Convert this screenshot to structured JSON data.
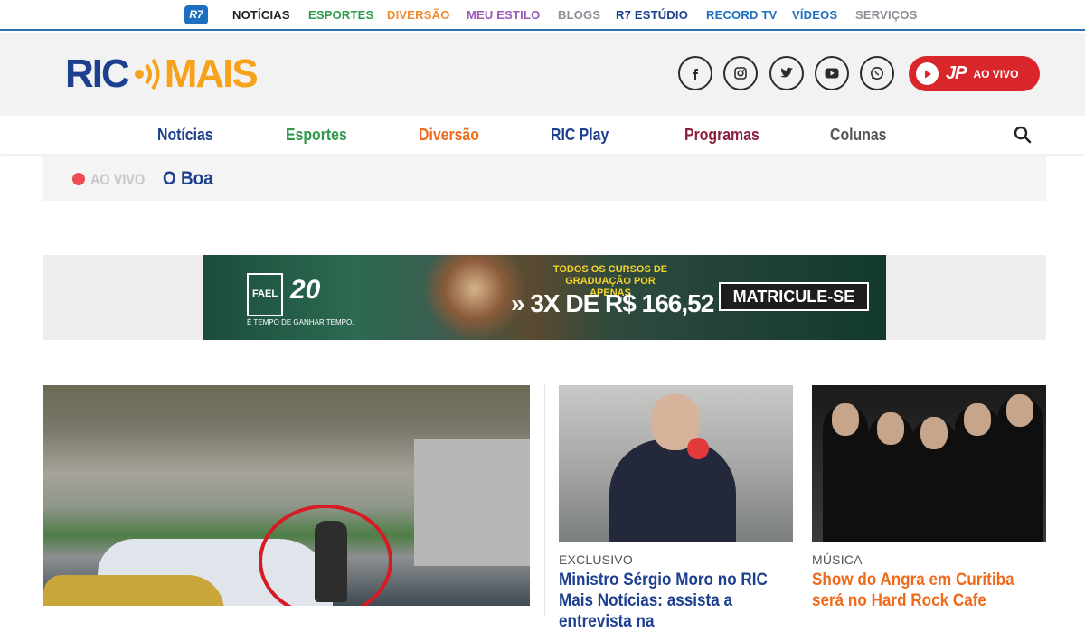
{
  "r7bar": {
    "logo": "R7",
    "items": [
      {
        "label": "NOTÍCIAS",
        "color": "#222222"
      },
      {
        "label": "ESPORTES",
        "color": "#2e9a4a"
      },
      {
        "label": "DIVERSÃO",
        "color": "#f08a2c"
      },
      {
        "label": "MEU ESTILO",
        "color": "#9b59b6"
      },
      {
        "label": "BLOGS",
        "color": "#8a8f96"
      },
      {
        "label": "R7 ESTÚDIO",
        "color": "#1d3f8f"
      },
      {
        "label": "RECORD TV",
        "color": "#1f6fc0"
      },
      {
        "label": "VÍDEOS",
        "color": "#1f6fc0"
      },
      {
        "label": "SERVIÇOS",
        "color": "#8a8f96"
      }
    ]
  },
  "header": {
    "logo_ric": "RIC",
    "logo_mais": "MAIS",
    "social": [
      "facebook-icon",
      "instagram-icon",
      "twitter-icon",
      "youtube-icon",
      "whatsapp-icon"
    ],
    "live_button": {
      "brand": "JP",
      "label": "AO VIVO"
    }
  },
  "nav": {
    "items": [
      {
        "label": "Notícias",
        "color": "#1d3f8f"
      },
      {
        "label": "Esportes",
        "color": "#2e9a4a"
      },
      {
        "label": "Diversão",
        "color": "#f06a1c"
      },
      {
        "label": "RIC Play",
        "color": "#1d3f8f"
      },
      {
        "label": "Programas",
        "color": "#8a1f3c"
      },
      {
        "label": "Colunas",
        "color": "#555555"
      }
    ]
  },
  "live_strip": {
    "label": "AO VIVO",
    "show": "O Boa"
  },
  "ad": {
    "brand": "FAEL",
    "anniversary": "20",
    "tagline": "É TEMPO DE GANHAR TEMPO.",
    "headline": "TODOS OS CURSOS DE GRADUAÇÃO POR APENAS",
    "price": "» 3X DE R$ 166,52",
    "cta": "MATRICULE-SE"
  },
  "articles": [
    {
      "kicker": "EXCLUSIVO",
      "title": "Ministro Sérgio Moro no RIC Mais Notícias: assista a entrevista na",
      "color": "#1d3f8f"
    },
    {
      "kicker": "MÚSICA",
      "title": "Show do Angra em Curitiba será no Hard Rock Cafe",
      "color": "#f06a1c"
    }
  ]
}
